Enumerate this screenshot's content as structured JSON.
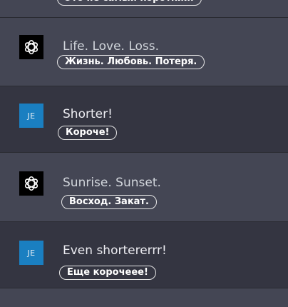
{
  "conversation": [
    {
      "role": "assistant",
      "avatar": "openai-logo-icon",
      "text": "",
      "translation": "Это не самый короткий."
    },
    {
      "role": "assistant",
      "avatar": "openai-logo-icon",
      "text": "Life. Love. Loss.",
      "translation": "Жизнь. Любовь. Потеря."
    },
    {
      "role": "user",
      "avatar_initials": "JE",
      "text": "Shorter!",
      "translation": "Короче!"
    },
    {
      "role": "assistant",
      "avatar": "openai-logo-icon",
      "text": "Sunrise. Sunset.",
      "translation": "Восход. Закат."
    },
    {
      "role": "user",
      "avatar_initials": "JE",
      "text": "Even shortererrr!",
      "translation": "Еще корочеее!"
    }
  ],
  "colors": {
    "assistant_bg": "#444654",
    "user_bg": "#343541",
    "user_avatar": "#1a7fc1"
  }
}
